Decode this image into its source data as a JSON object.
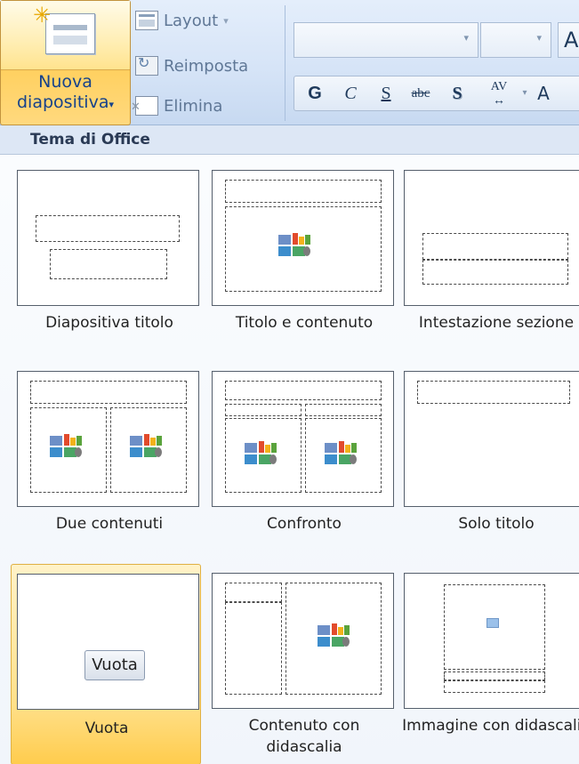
{
  "ribbon": {
    "new_slide": {
      "line1": "Nuova",
      "line2": "diapositiva",
      "caret": "▾"
    },
    "layout": {
      "label": "Layout",
      "caret": "▾"
    },
    "reset": {
      "label": "Reimposta"
    },
    "delete": {
      "label": "Elimina"
    },
    "font": {
      "font_name": "",
      "font_size": "",
      "caret": "▾",
      "grow_letter": "A"
    },
    "format": {
      "bold": "G",
      "italic": "C",
      "underline": "S",
      "strikethrough": "abc",
      "shadow": "S",
      "spacing": "AV",
      "spacing_arrow": "↔",
      "caret": "▾",
      "case_letter": "A"
    }
  },
  "gallery": {
    "theme_title": "Tema di Office",
    "layouts": [
      {
        "label": "Diapositiva titolo"
      },
      {
        "label": "Titolo e contenuto"
      },
      {
        "label": "Intestazione sezione"
      },
      {
        "label": "Due contenuti"
      },
      {
        "label": "Confronto"
      },
      {
        "label": "Solo titolo"
      },
      {
        "label": "Vuota",
        "preview_button": "Vuota",
        "selected": true
      },
      {
        "label": "Contenuto con didascalia"
      },
      {
        "label": "Immagine con didascalia"
      }
    ]
  },
  "colors": {
    "accent_selected": "#ffe08a",
    "ribbon_blue": "#d6e4f7",
    "ribbon_text": "#15428b"
  }
}
